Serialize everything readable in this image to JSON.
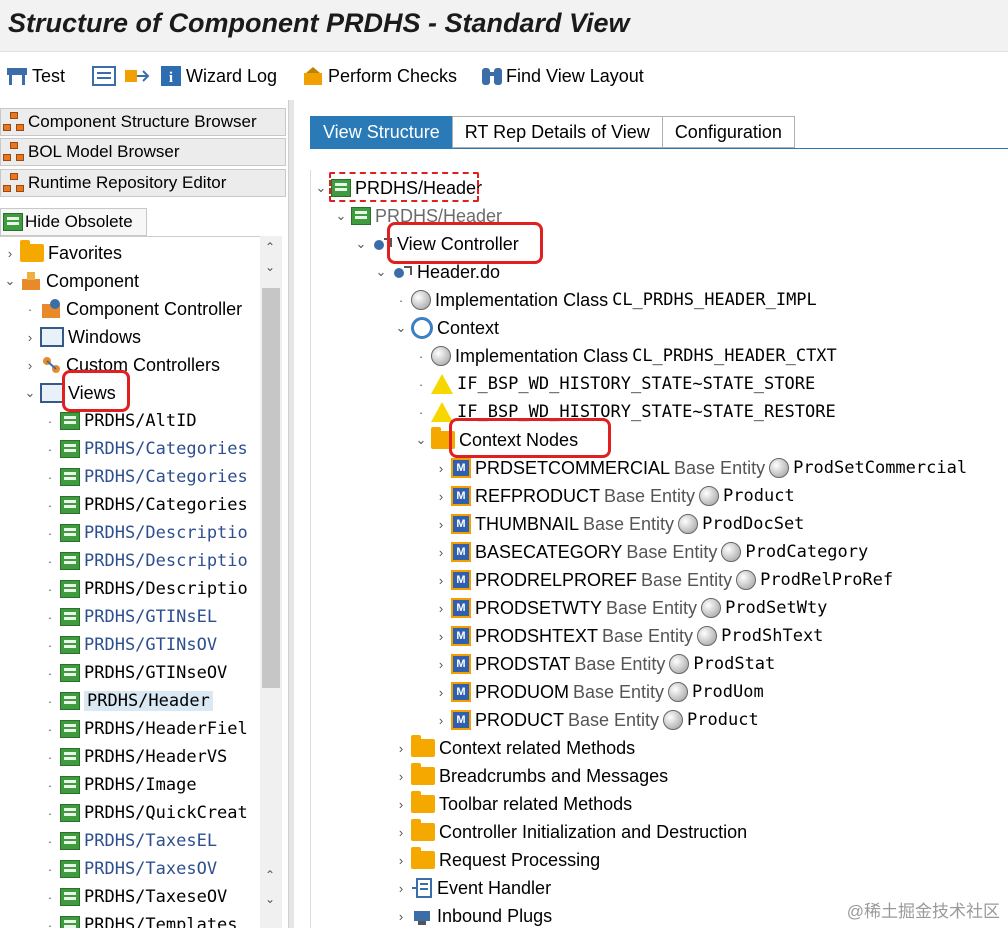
{
  "title": "Structure of Component PRDHS - Standard View",
  "toolbar": {
    "test": "Test",
    "wizard_log": "Wizard Log",
    "perform_checks": "Perform Checks",
    "find_view_layout": "Find View Layout"
  },
  "left_nav": {
    "component_structure_browser": "Component Structure Browser",
    "bol_model_browser": "BOL Model Browser",
    "runtime_repository_editor": "Runtime Repository Editor",
    "hide_obsolete": "Hide Obsolete"
  },
  "left_tree": {
    "favorites": "Favorites",
    "component": "Component",
    "component_controller": "Component Controller",
    "windows": "Windows",
    "custom_controllers": "Custom Controllers",
    "views": "Views",
    "view_items": [
      {
        "label": "PRDHS/AltID",
        "blue": false
      },
      {
        "label": "PRDHS/Categories",
        "blue": true
      },
      {
        "label": "PRDHS/Categories",
        "blue": true
      },
      {
        "label": "PRDHS/Categories",
        "blue": false
      },
      {
        "label": "PRDHS/Descriptio",
        "blue": true
      },
      {
        "label": "PRDHS/Descriptio",
        "blue": true
      },
      {
        "label": "PRDHS/Descriptio",
        "blue": false
      },
      {
        "label": "PRDHS/GTINsEL",
        "blue": true
      },
      {
        "label": "PRDHS/GTINsOV",
        "blue": true
      },
      {
        "label": "PRDHS/GTINseOV",
        "blue": false
      },
      {
        "label": "PRDHS/Header",
        "blue": false,
        "selected": true
      },
      {
        "label": "PRDHS/HeaderFiel",
        "blue": false
      },
      {
        "label": "PRDHS/HeaderVS",
        "blue": false
      },
      {
        "label": "PRDHS/Image",
        "blue": false
      },
      {
        "label": "PRDHS/QuickCreat",
        "blue": false
      },
      {
        "label": "PRDHS/TaxesEL",
        "blue": true
      },
      {
        "label": "PRDHS/TaxesOV",
        "blue": true
      },
      {
        "label": "PRDHS/TaxeseOV",
        "blue": false
      },
      {
        "label": "PRDHS/Templates",
        "blue": false
      }
    ]
  },
  "tabs": [
    "View Structure",
    "RT Rep Details of View",
    "Configuration"
  ],
  "right_tree": {
    "root": "PRDHS/Header",
    "view": "PRDHS/Header",
    "view_controller": "View Controller",
    "header_do": "Header.do",
    "impl_label": "Implementation Class",
    "impl_value": "CL_PRDHS_HEADER_IMPL",
    "context": "Context",
    "ctx_impl_label": "Implementation Class",
    "ctx_impl_value": "CL_PRDHS_HEADER_CTXT",
    "state_store": "IF_BSP_WD_HISTORY_STATE~STATE_STORE",
    "state_restore": "IF_BSP_WD_HISTORY_STATE~STATE_RESTORE",
    "context_nodes": "Context Nodes",
    "base_entity_label": "Base Entity",
    "nodes": [
      {
        "name": "PRDSETCOMMERCIAL",
        "entity": "ProdSetCommercial"
      },
      {
        "name": "REFPRODUCT",
        "entity": "Product"
      },
      {
        "name": "THUMBNAIL",
        "entity": "ProdDocSet"
      },
      {
        "name": "BASECATEGORY",
        "entity": "ProdCategory"
      },
      {
        "name": "PRODRELPROREF",
        "entity": "ProdRelProRef"
      },
      {
        "name": "PRODSETWTY",
        "entity": "ProdSetWty"
      },
      {
        "name": "PRODSHTEXT",
        "entity": "ProdShText"
      },
      {
        "name": "PRODSTAT",
        "entity": "ProdStat"
      },
      {
        "name": "PRODUOM",
        "entity": "ProdUom"
      },
      {
        "name": "PRODUCT",
        "entity": "Product"
      }
    ],
    "folders": [
      "Context related Methods",
      "Breadcrumbs and Messages",
      "Toolbar related Methods",
      "Controller Initialization and Destruction",
      "Request Processing"
    ],
    "event_handler": "Event Handler",
    "inbound_plugs": "Inbound Plugs"
  },
  "watermark": "@稀土掘金技术社区",
  "colors": {
    "tab_active": "#2a7ab8",
    "highlight": "#e02020",
    "link_blue": "#2e4f8f"
  }
}
